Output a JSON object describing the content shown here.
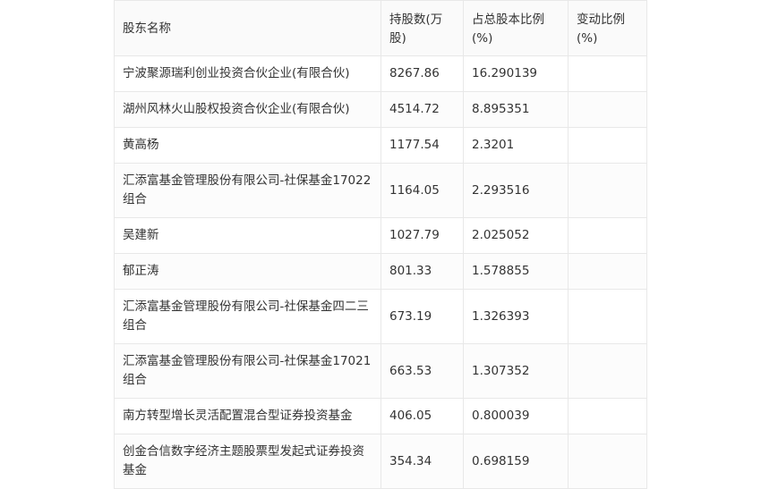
{
  "table": {
    "headers": [
      "股东名称",
      "持股数(万股)",
      "占总股本比例(%)",
      "变动比例(%)"
    ],
    "rows": [
      {
        "name": "宁波聚源瑞利创业投资合伙企业(有限合伙)",
        "shares": "8267.86",
        "ratio": "16.290139",
        "change": ""
      },
      {
        "name": "湖州风林火山股权投资合伙企业(有限合伙)",
        "shares": "4514.72",
        "ratio": "8.895351",
        "change": ""
      },
      {
        "name": "黄高杨",
        "shares": "1177.54",
        "ratio": "2.3201",
        "change": ""
      },
      {
        "name": "汇添富基金管理股份有限公司-社保基金17022组合",
        "shares": "1164.05",
        "ratio": "2.293516",
        "change": ""
      },
      {
        "name": "吴建新",
        "shares": "1027.79",
        "ratio": "2.025052",
        "change": ""
      },
      {
        "name": "郁正涛",
        "shares": "801.33",
        "ratio": "1.578855",
        "change": ""
      },
      {
        "name": "汇添富基金管理股份有限公司-社保基金四二三组合",
        "shares": "673.19",
        "ratio": "1.326393",
        "change": ""
      },
      {
        "name": "汇添富基金管理股份有限公司-社保基金17021组合",
        "shares": "663.53",
        "ratio": "1.307352",
        "change": ""
      },
      {
        "name": "南方转型增长灵活配置混合型证券投资基金",
        "shares": "406.05",
        "ratio": "0.800039",
        "change": ""
      },
      {
        "name": "创金合信数字经济主题股票型发起式证券投资基金",
        "shares": "354.34",
        "ratio": "0.698159",
        "change": ""
      }
    ]
  }
}
